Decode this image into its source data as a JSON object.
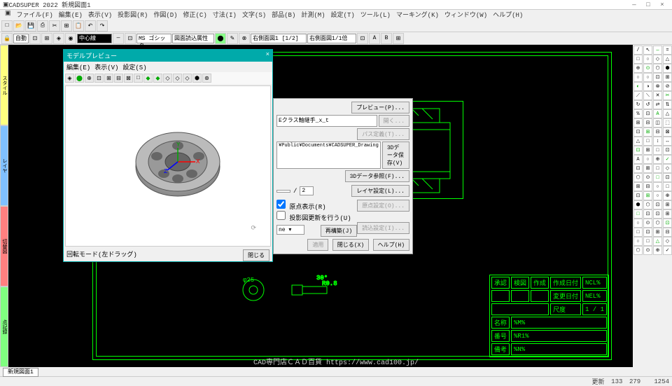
{
  "app": {
    "title": "CADSUPER 2022 新規図面1",
    "min": "—",
    "max": "□",
    "close": "×",
    "menus": [
      "ファイル(F)",
      "編集(E)",
      "表示(V)",
      "投影図(R)",
      "作図(D)",
      "修正(C)",
      "寸法(I)",
      "文字(S)",
      "部品(B)",
      "計測(M)",
      "設定(T)",
      "ツール(L)",
      "マーキング(K)",
      "ウィンドウ(W)",
      "ヘルプ(H)"
    ]
  },
  "tb2": {
    "auto": "自動",
    "linetype": "中心線",
    "font": "MS ゴシック",
    "attr": "図面読込属性",
    "combo1": "右側面図1 [1/2]",
    "combo2": "右側面図1/1倍"
  },
  "lefttabs": [
    "スタイル",
    "レイヤ",
    "切替図",
    "点記録"
  ],
  "preview_dlg": {
    "title": "モデルプレビュー",
    "menus": [
      "編集(E)",
      "表示(V)",
      "設定(S)"
    ],
    "status": "回転モード(左ドラッグ)",
    "close_btn": "閉じる",
    "axes": [
      "X",
      "Y",
      "Z"
    ]
  },
  "dlg2": {
    "path1": "Eクラス軸継手_x_t",
    "path2": "¥Public¥Documents¥CADSUPER_Drawing",
    "num": "2",
    "chk1": "原点表示(R)",
    "chk2": "投影図更新を行う(U)",
    "preview": "プレビュー(P)...",
    "b1": "開く...",
    "b2": "パス定義(T)...",
    "b3": "3Dデータ保存(V)",
    "b4": "3Dデータ参照(F)...",
    "b5": "レイヤ設定(L)...",
    "b6": "原点設定(O)...",
    "b7": "読込設定(I)...",
    "b8": "再構築(J)",
    "apply": "適用",
    "close": "閉じる(X)",
    "help": "ヘルプ(H)"
  },
  "titleblock": {
    "h": [
      "承認",
      "検図",
      "作成",
      "作成日付",
      "NCL%"
    ],
    "r2": [
      "",
      "",
      "",
      "変更日付",
      "NEL%"
    ],
    "r3": [
      "尺度",
      "1 / 1"
    ],
    "name": "名称",
    "nmn": "%M%",
    "num": "番号",
    "nrn": "%R1%",
    "remark": "備考",
    "nnn": "%N%"
  },
  "dims": [
    "φ25",
    "30°",
    "R0.8"
  ],
  "statusbar": {
    "tab": "新規図面1",
    "upd": "更新",
    "x": "133",
    "y": "279",
    "z": "1254"
  },
  "watermark": "CAD専門店ＣＡＤ百貨 https://www.cad100.jp/",
  "righticons": [
    "/",
    "↖",
    "—",
    "=",
    "□",
    "○",
    "◇",
    "△",
    "⊕",
    "⊙",
    "⬡",
    "⬢",
    "○",
    "○",
    "⊡",
    "⊞",
    "◐",
    "◑",
    "⊗",
    "⊘",
    "⟋",
    "⟍",
    "✕",
    "✂",
    "↻",
    "↺",
    "⇄",
    "⇅",
    "% ",
    "⊡",
    "A",
    "△",
    "⊞",
    "⊟",
    "◫",
    "⬚",
    "⊡",
    "⊞",
    "⊟",
    "⊠",
    "△",
    "□",
    "↕",
    "↔",
    "⊡",
    "⊞",
    "□",
    "⊡",
    "A",
    "○",
    "⊕",
    "✓",
    "⊡",
    "⊞",
    "□",
    "◇",
    "⬡",
    "⊙",
    "□",
    "⊡",
    "⊞",
    "⊟",
    "○",
    "□",
    "⊡",
    "⊞",
    "○",
    "⊕",
    "⬢",
    "⬡",
    "⊡",
    "⊞",
    "□",
    "⊡",
    "⊡",
    "⊞",
    "○",
    "⊙",
    "⬡",
    "⊡",
    "□",
    "⊡",
    "⊞",
    "⊟",
    "○",
    "□",
    "△",
    "◇",
    "⬡",
    "⊙",
    "⊕",
    "✓"
  ]
}
